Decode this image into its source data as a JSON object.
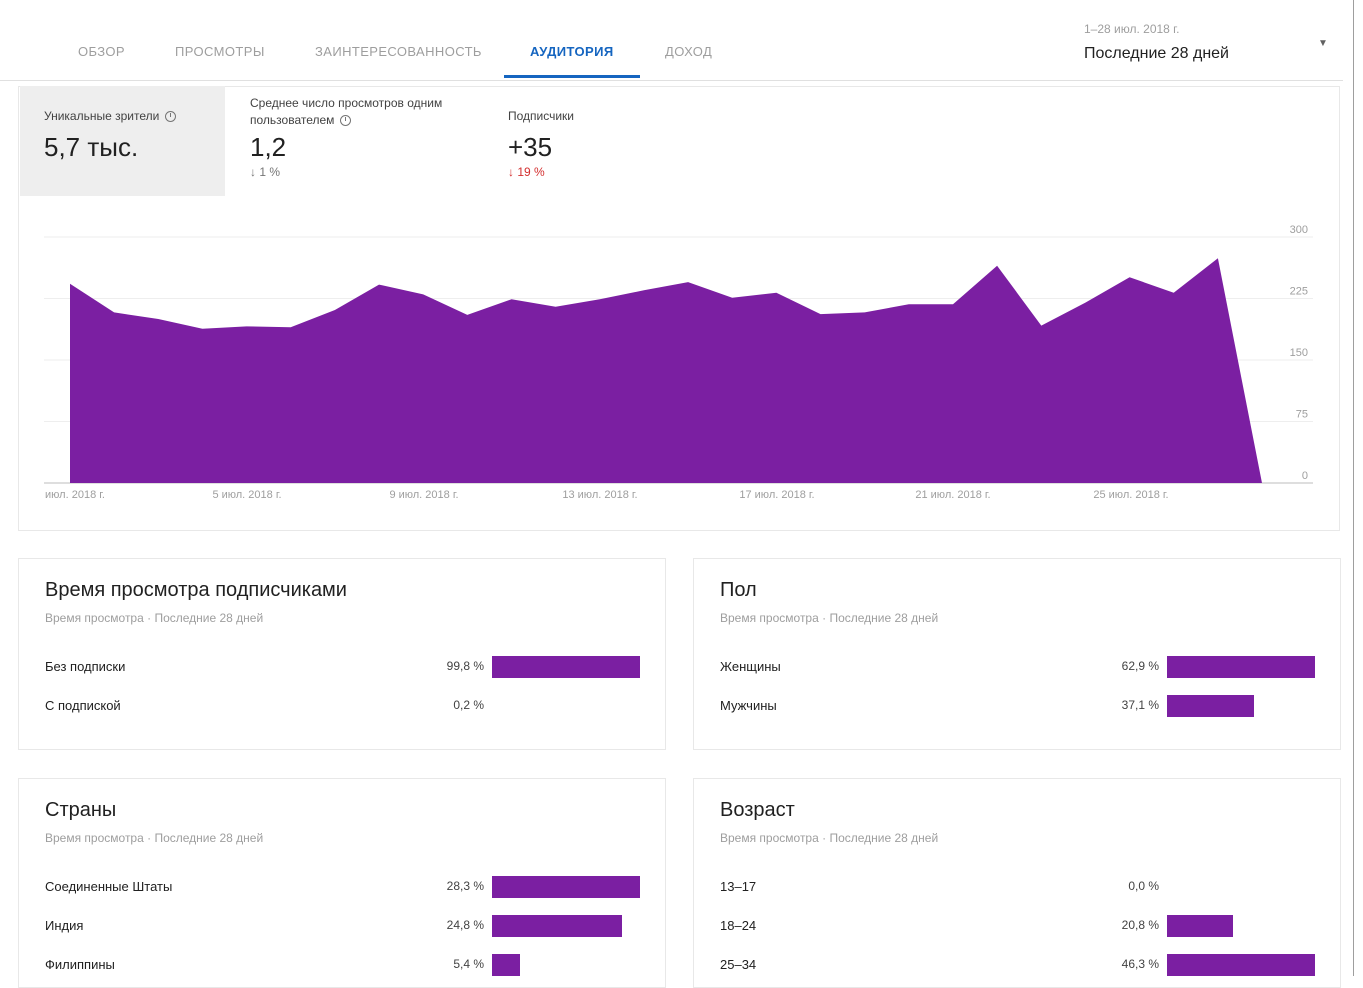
{
  "tabs": [
    "ОБЗОР",
    "ПРОСМОТРЫ",
    "ЗАИНТЕРЕСОВАННОСТЬ",
    "АУДИТОРИЯ",
    "ДОХОД"
  ],
  "active_tab": "АУДИТОРИЯ",
  "date_range": {
    "dates": "1–28 июл. 2018 г.",
    "label": "Последние 28 дней"
  },
  "metrics": [
    {
      "label": "Уникальные зрители",
      "value": "5,7 тыс.",
      "change": "",
      "trend": "none",
      "selected": true
    },
    {
      "label": "Среднее число просмотров одним пользователем",
      "value": "1,2",
      "change": "↓ 1 %",
      "trend": "down",
      "selected": false
    },
    {
      "label": "Подписчики",
      "value": "+35",
      "change": "↓ 19 %",
      "trend": "down-red",
      "selected": false
    }
  ],
  "chart_data": {
    "type": "area",
    "x": [
      "1 июл.",
      "2 июл.",
      "3 июл.",
      "4 июл.",
      "5 июл.",
      "6 июл.",
      "7 июл.",
      "8 июл.",
      "9 июл.",
      "10 июл.",
      "11 июл.",
      "12 июл.",
      "13 июл.",
      "14 июл.",
      "15 июл.",
      "16 июл.",
      "17 июл.",
      "18 июл.",
      "19 июл.",
      "20 июл.",
      "21 июл.",
      "22 июл.",
      "23 июл.",
      "24 июл.",
      "25 июл.",
      "26 июл.",
      "27 июл.",
      "28 июл."
    ],
    "values": [
      243,
      208,
      200,
      188,
      191,
      190,
      211,
      242,
      230,
      205,
      224,
      215,
      224,
      235,
      245,
      226,
      232,
      206,
      208,
      218,
      218,
      265,
      192,
      220,
      251,
      232,
      274,
      0
    ],
    "y_ticks": [
      "300",
      "225",
      "150",
      "75",
      "0"
    ],
    "x_tick_labels": [
      "июл. 2018 г.",
      "5 июл. 2018 г.",
      "9 июл. 2018 г.",
      "13 июл. 2018 г.",
      "17 июл. 2018 г.",
      "21 июл. 2018 г.",
      "25 июл. 2018 г."
    ],
    "ylim": [
      0,
      300
    ],
    "color": "#7b1fa2",
    "grid": true
  },
  "cards": {
    "subscribers": {
      "title": "Время просмотра подписчиками",
      "subtitle": "Время просмотра · Последние 28 дней",
      "rows": [
        {
          "label": "Без подписки",
          "value": "99,8 %",
          "fraction": 0.998
        },
        {
          "label": "С подпиской",
          "value": "0,2 %",
          "fraction": 0.002
        }
      ]
    },
    "gender": {
      "title": "Пол",
      "subtitle": "Время просмотра · Последние 28 дней",
      "rows": [
        {
          "label": "Женщины",
          "value": "62,9 %",
          "fraction": 0.629
        },
        {
          "label": "Мужчины",
          "value": "37,1 %",
          "fraction": 0.371
        }
      ]
    },
    "countries": {
      "title": "Страны",
      "subtitle": "Время просмотра · Последние 28 дней",
      "rows": [
        {
          "label": "Соединенные Штаты",
          "value": "28,3 %",
          "fraction": 0.283
        },
        {
          "label": "Индия",
          "value": "24,8 %",
          "fraction": 0.248
        },
        {
          "label": "Филиппины",
          "value": "5,4 %",
          "fraction": 0.054
        }
      ]
    },
    "age": {
      "title": "Возраст",
      "subtitle": "Время просмотра · Последние 28 дней",
      "rows": [
        {
          "label": "13–17",
          "value": "0,0 %",
          "fraction": 0.0
        },
        {
          "label": "18–24",
          "value": "20,8 %",
          "fraction": 0.208
        },
        {
          "label": "25–34",
          "value": "46,3 %",
          "fraction": 0.463
        }
      ]
    }
  },
  "colors": {
    "accent": "#1565c0",
    "bar": "#7b1fa2",
    "negative": "#d32f2f"
  }
}
